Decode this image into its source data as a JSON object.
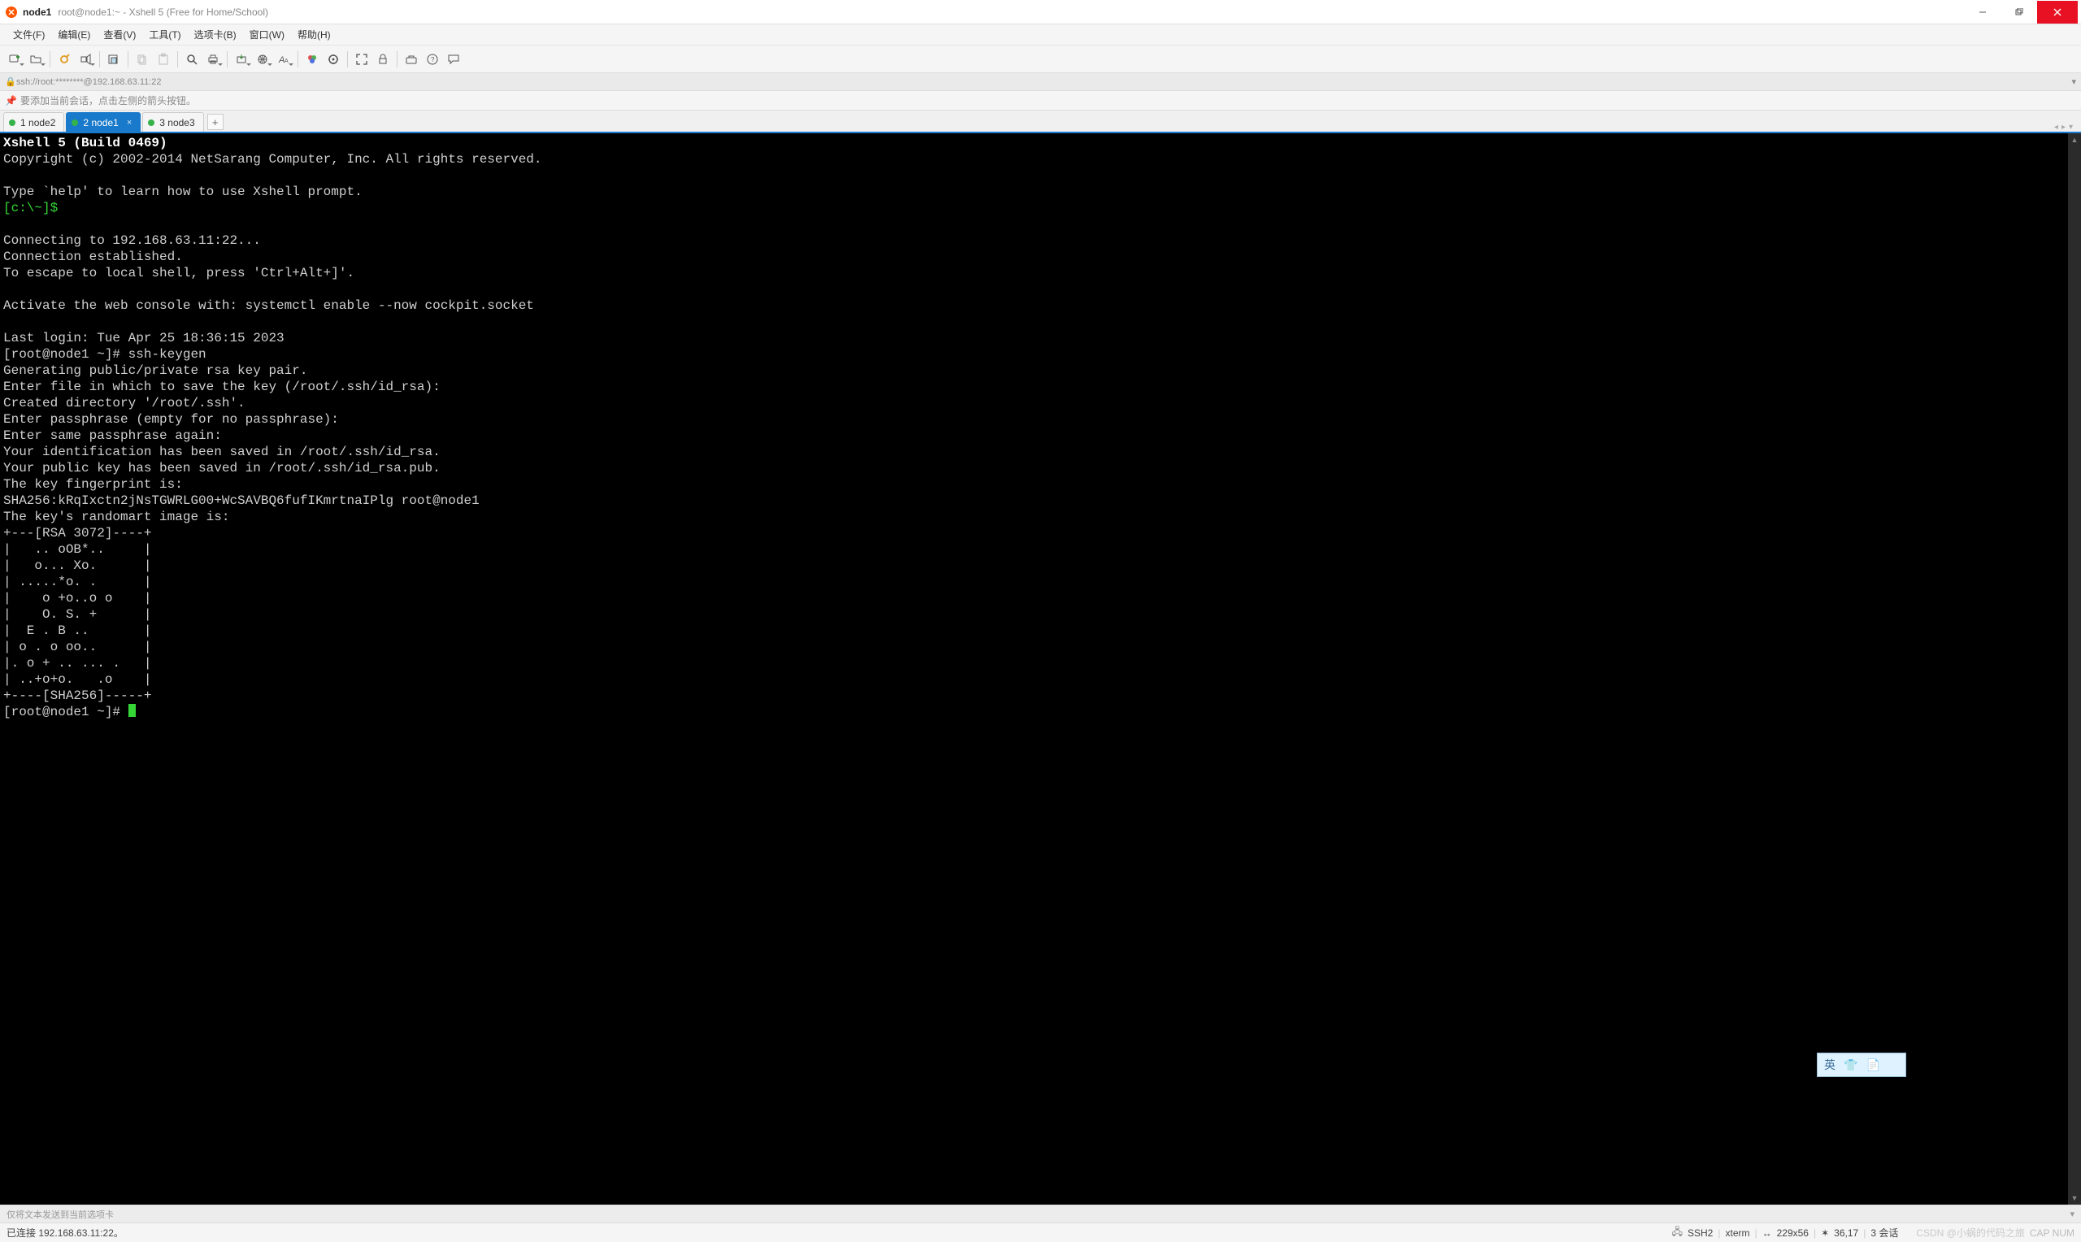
{
  "title": {
    "session": "node1",
    "rest": "root@node1:~ - Xshell 5 (Free for Home/School)"
  },
  "menu": {
    "file": "文件(F)",
    "edit": "编辑(E)",
    "view": "查看(V)",
    "tools": "工具(T)",
    "tabs": "选项卡(B)",
    "window": "窗口(W)",
    "help": "帮助(H)"
  },
  "address": "ssh://root:********@192.168.63.11:22",
  "hint": "要添加当前会话，点击左侧的箭头按钮。",
  "tabs": [
    {
      "index": "1",
      "label": "node2"
    },
    {
      "index": "2",
      "label": "node1"
    },
    {
      "index": "3",
      "label": "node3"
    }
  ],
  "terminal": {
    "header1": "Xshell 5 (Build 0469)",
    "header2": "Copyright (c) 2002-2014 NetSarang Computer, Inc. All rights reserved.",
    "help": "Type `help' to learn how to use Xshell prompt.",
    "localprompt": "[c:\\~]$",
    "connecting": "Connecting to 192.168.63.11:22...",
    "established": "Connection established.",
    "escape": "To escape to local shell, press 'Ctrl+Alt+]'.",
    "activate": "Activate the web console with: systemctl enable --now cockpit.socket",
    "lastlogin": "Last login: Tue Apr 25 18:36:15 2023",
    "prompt1": "[root@node1 ~]# ssh-keygen",
    "gen": "Generating public/private rsa key pair.",
    "enterfile": "Enter file in which to save the key (/root/.ssh/id_rsa): ",
    "created": "Created directory '/root/.ssh'.",
    "pass1": "Enter passphrase (empty for no passphrase): ",
    "pass2": "Enter same passphrase again: ",
    "ident": "Your identification has been saved in /root/.ssh/id_rsa.",
    "pub": "Your public key has been saved in /root/.ssh/id_rsa.pub.",
    "fp": "The key fingerprint is:",
    "sha": "SHA256:kRqIxctn2jNsTGWRLG00+WcSAVBQ6fufIKmrtnaIPlg root@node1",
    "art": "The key's randomart image is:",
    "a01": "+---[RSA 3072]----+",
    "a02": "|   .. oOB*..     |",
    "a03": "|   o... Xo.      |",
    "a04": "| .....*o. .      |",
    "a05": "|    o +o..o o    |",
    "a06": "|    O. S. +      |",
    "a07": "|  E . B ..       |",
    "a08": "| o . o oo..      |",
    "a09": "|. o + .. ... .   |",
    "a10": "| ..+o+o.   .o    |",
    "a11": "+----[SHA256]-----+",
    "prompt2": "[root@node1 ~]# "
  },
  "ime": {
    "lang": "英"
  },
  "sendbar": "仅将文本发送到当前选项卡",
  "status": {
    "connected": "已连接 192.168.63.11:22。",
    "ssh": "SSH2",
    "term": "xterm",
    "size": "229x56",
    "cursor": "36,17",
    "sessions": "3 会话",
    "capnum": "CAP  NUM",
    "watermark": "CSDN @小蜗的代码之旅"
  }
}
